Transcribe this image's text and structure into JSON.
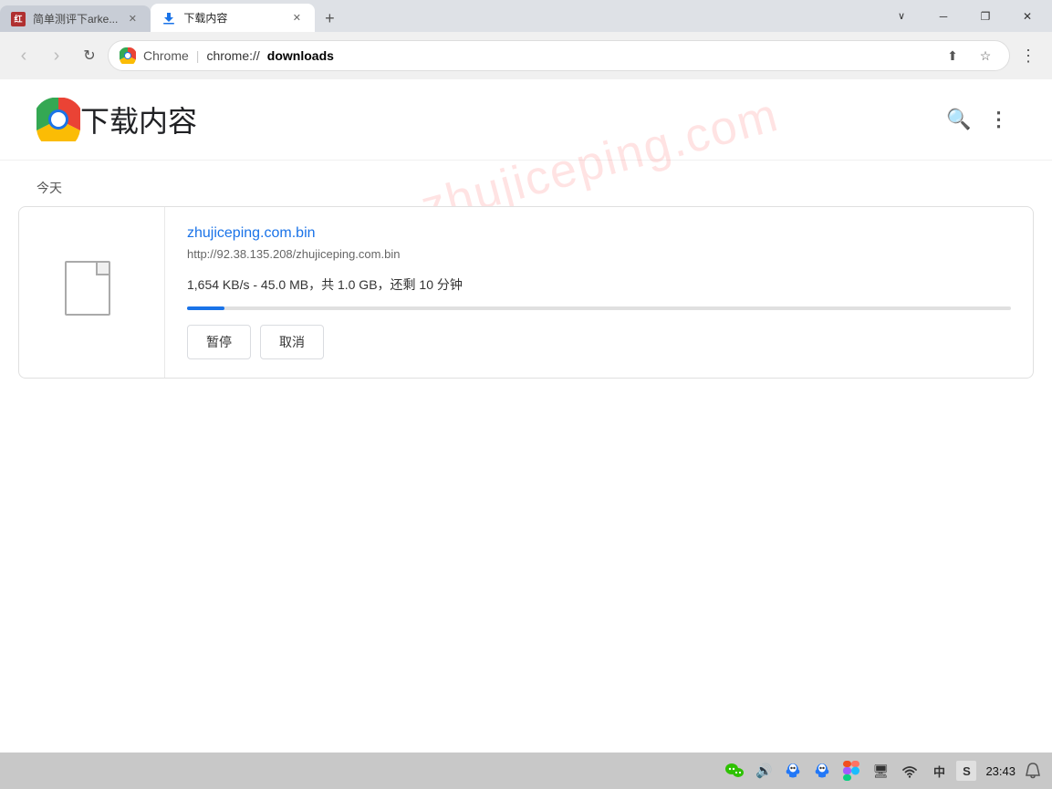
{
  "window": {
    "title": "下载内容",
    "minimize_label": "─",
    "restore_label": "❐",
    "close_label": "✕"
  },
  "tabs": [
    {
      "id": "tab1",
      "title": "简单测评下arke...",
      "active": false,
      "favicon": "红"
    },
    {
      "id": "tab2",
      "title": "下载内容",
      "active": true,
      "favicon": "download"
    }
  ],
  "new_tab_label": "+",
  "address_bar": {
    "chrome_label": "Chrome",
    "url_protocol": "chrome://",
    "url_path": "downloads",
    "full_url": "chrome://downloads"
  },
  "nav": {
    "back_label": "‹",
    "forward_label": "›",
    "reload_label": "↻"
  },
  "address_icons": {
    "share_label": "⬆",
    "bookmark_label": "☆",
    "menu_label": "⋮"
  },
  "page": {
    "logo_alt": "Chrome logo",
    "title": "下载内容",
    "search_label": "🔍",
    "menu_label": "⋮",
    "watermark": "zhujiceping.com",
    "today_label": "今天"
  },
  "download_item": {
    "filename": "zhujiceping.com.bin",
    "url": "http://92.38.135.208/zhujiceping.com.bin",
    "stats": "1,654 KB/s - 45.0 MB，共 1.0 GB，还剩 10 分钟",
    "progress_percent": 4.5,
    "pause_label": "暂停",
    "cancel_label": "取消"
  },
  "taskbar": {
    "wechat_icon": "💬",
    "volume_icon": "🔊",
    "qq1_icon": "🐧",
    "qq2_icon": "🐧",
    "figma_icon": "✦",
    "screen_icon": "🖥",
    "wifi_icon": "▲",
    "lang_icon": "中",
    "ime_icon": "S",
    "time": "23:43",
    "notification_icon": "🗨"
  }
}
